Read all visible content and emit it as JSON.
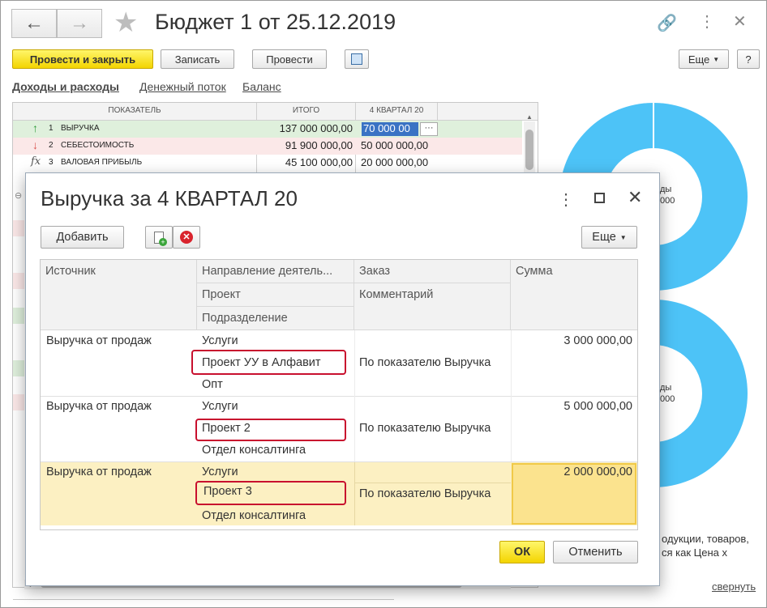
{
  "window": {
    "title": "Бюджет 1 от 25.12.2019",
    "buttons": {
      "post_close": "Провести и закрыть",
      "write": "Записать",
      "post": "Провести",
      "more": "Еще",
      "help": "?"
    },
    "tabs": [
      "Доходы и расходы",
      "Денежный поток",
      "Баланс"
    ],
    "grid": {
      "headers": [
        "ПОКАЗАТЕЛЬ",
        "ИТОГО",
        "4 КВАРТАЛ 20"
      ],
      "rows": [
        {
          "num": "1",
          "name": "ВЫРУЧКА",
          "total": "137 000 000,00",
          "q4": "70 000 00"
        },
        {
          "num": "2",
          "name": "СЕБЕСТОИМОСТЬ",
          "total": "91 900 000,00",
          "q4": "50 000 000,00"
        },
        {
          "num": "3",
          "name": "ВАЛОВАЯ ПРИБЫЛЬ",
          "total": "45 100 000,00",
          "q4": "20 000 000,00"
        }
      ],
      "ellipsis": "···"
    },
    "right_panel": {
      "donut1_label1": "ды",
      "donut1_label2": "000",
      "donut2_label1": "ды",
      "donut2_label2": "000",
      "note_line1": "одукции,  товаров,",
      "note_line2": "ся как Цена х",
      "collapse": "свернуть"
    },
    "colors": {
      "accent_yellow": "#f3d400",
      "donut": "#4dc3f7",
      "highlight_row": "#fcf0c2",
      "red_box": "#c8102e"
    }
  },
  "dialog": {
    "title": "Выручка за 4 КВАРТАЛ 20",
    "add_label": "Добавить",
    "more_label": "Еще",
    "columns": {
      "source": "Источник",
      "direction": "Направление деятель...",
      "project": "Проект",
      "department": "Подразделение",
      "order": "Заказ",
      "comment": "Комментарий",
      "amount": "Сумма"
    },
    "rows": [
      {
        "source": "Выручка от продаж",
        "direction": "Услуги",
        "project": "Проект УУ в Алфавит",
        "department": "Опт",
        "order": "",
        "comment": "По показателю Выручка",
        "amount": "3 000 000,00"
      },
      {
        "source": "Выручка от продаж",
        "direction": "Услуги",
        "project": "Проект 2",
        "department": "Отдел консалтинга",
        "order": "",
        "comment": "По показателю Выручка",
        "amount": "5 000 000,00"
      },
      {
        "source": "Выручка от продаж",
        "direction": "Услуги",
        "project": "Проект 3",
        "department": "Отдел консалтинга",
        "order": "",
        "comment": "По показателю Выручка",
        "amount": "2 000 000,00"
      }
    ],
    "ok_label": "ОК",
    "cancel_label": "Отменить"
  }
}
